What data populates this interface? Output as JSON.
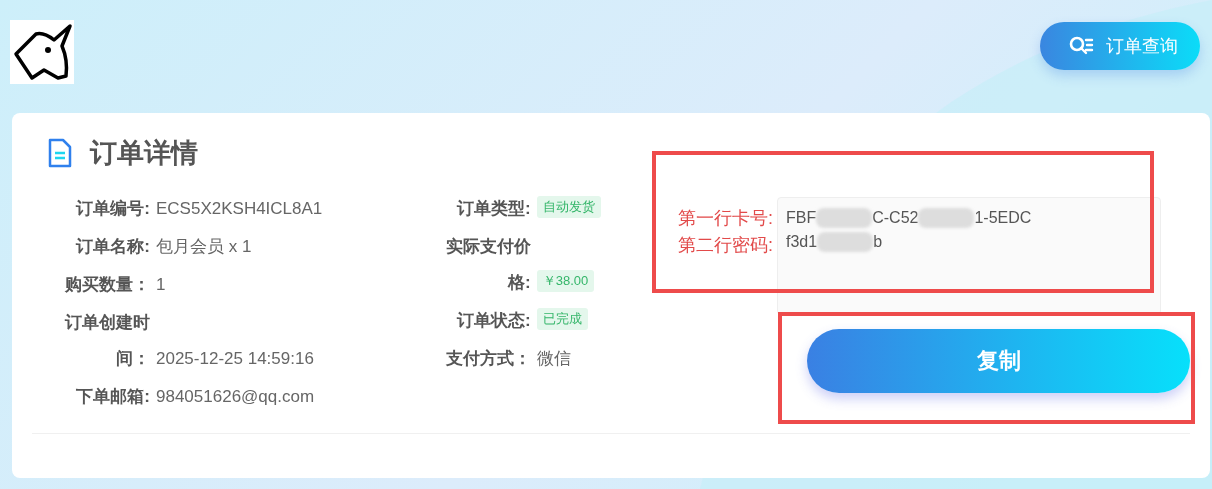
{
  "header": {
    "query_button": "订单查询"
  },
  "card": {
    "title": "订单详情",
    "left_fields": [
      {
        "label": "订单编号:",
        "value": "ECS5X2KSH4ICL8A1",
        "kind": "text"
      },
      {
        "label": "订单名称:",
        "value": "包月会员 x 1",
        "kind": "text"
      },
      {
        "label": "购买数量：",
        "value": "1",
        "kind": "text"
      },
      {
        "label": "订单创建时间：",
        "value": "2025-12-25 14:59:16",
        "kind": "text"
      },
      {
        "label": "下单邮箱:",
        "value": "984051626@qq.com",
        "kind": "text"
      }
    ],
    "right_fields": [
      {
        "label": "订单类型:",
        "value": "自动发货",
        "kind": "tag"
      },
      {
        "label": "实际支付价格:",
        "value": "￥38.00",
        "kind": "tag"
      },
      {
        "label": "订单状态:",
        "value": "已完成",
        "kind": "tag"
      },
      {
        "label": "支付方式：",
        "value": "微信",
        "kind": "text"
      }
    ],
    "credentials": {
      "highlighted": true,
      "labels": [
        "第一行卡号:",
        "第二行密码:"
      ],
      "lines": [
        [
          {
            "kind": "text",
            "text": "FBF"
          },
          {
            "kind": "redacted"
          },
          {
            "kind": "text",
            "text": "C-C52"
          },
          {
            "kind": "redacted"
          },
          {
            "kind": "text",
            "text": "1-5EDC"
          }
        ],
        [
          {
            "kind": "text",
            "text": "f3d1"
          },
          {
            "kind": "redacted"
          },
          {
            "kind": "text",
            "text": "b"
          }
        ]
      ]
    },
    "copy_button": {
      "label": "复制",
      "highlighted": true
    }
  }
}
